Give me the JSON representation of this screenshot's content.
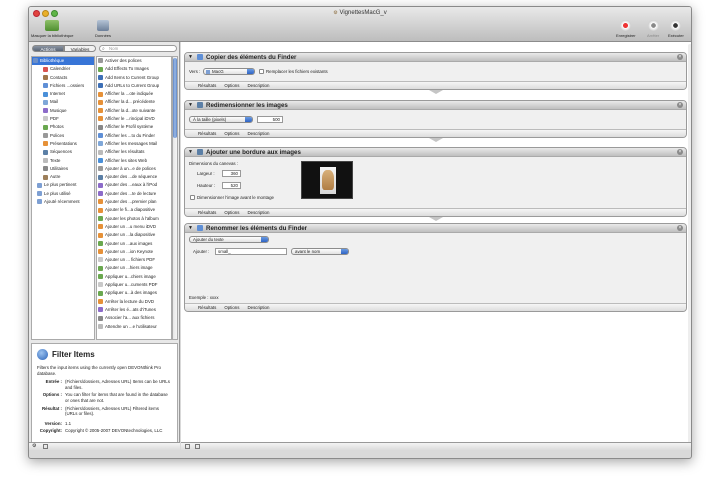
{
  "window": {
    "title": "VignettesMacG_v"
  },
  "toolbar": {
    "hide_library": "Masquer la bibliothèque",
    "data": "Données",
    "record": "Enregistrer",
    "stop": "Arrêter",
    "run": "Exécuter"
  },
  "library_tabs": {
    "actions": "Actions",
    "variables": "Variables"
  },
  "search": {
    "placeholder": "Nom"
  },
  "library": [
    {
      "label": "Bibliothèque",
      "icon": "library-icon",
      "color": "#6b8fc9",
      "selected": true
    },
    {
      "label": "Calendrier",
      "icon": "calendar-icon",
      "color": "#d9534f"
    },
    {
      "label": "Contacts",
      "icon": "contacts-icon",
      "color": "#a0754a"
    },
    {
      "label": "Fichiers ...ossiers",
      "icon": "finder-icon",
      "color": "#5f8fd6"
    },
    {
      "label": "Internet",
      "icon": "globe-icon",
      "color": "#4a90d9"
    },
    {
      "label": "Mail",
      "icon": "mail-icon",
      "color": "#7fa7d8"
    },
    {
      "label": "Musique",
      "icon": "music-icon",
      "color": "#8c6bc9"
    },
    {
      "label": "PDF",
      "icon": "pdf-icon",
      "color": "#c9c9c9"
    },
    {
      "label": "Photos",
      "icon": "photo-icon",
      "color": "#6aa84f"
    },
    {
      "label": "Polices",
      "icon": "font-icon",
      "color": "#999999"
    },
    {
      "label": "Présentations",
      "icon": "presentation-icon",
      "color": "#e69138"
    },
    {
      "label": "Séquences",
      "icon": "movie-icon",
      "color": "#5b7fa6"
    },
    {
      "label": "Texte",
      "icon": "text-icon",
      "color": "#bbbbbb"
    },
    {
      "label": "Utilitaires",
      "icon": "utility-icon",
      "color": "#888888"
    },
    {
      "label": "Autre",
      "icon": "automator-icon",
      "color": "#9d7f5a"
    },
    {
      "label": "Le plus pertinent",
      "icon": "folder-icon",
      "color": "#7d9fd3"
    },
    {
      "label": "Le plus utilisé",
      "icon": "folder-icon",
      "color": "#7d9fd3"
    },
    {
      "label": "Ajouté récemment",
      "icon": "folder-icon",
      "color": "#7d9fd3"
    }
  ],
  "actions": [
    {
      "label": "Activer des polices",
      "color": "#999999"
    },
    {
      "label": "Add Effects To Images",
      "color": "#6aa84f"
    },
    {
      "label": "Add Items to Current Group",
      "color": "#3d6fb6"
    },
    {
      "label": "Add URLs to Current Group",
      "color": "#3d6fb6"
    },
    {
      "label": "Afficher la ...ote indiquée",
      "color": "#e69138"
    },
    {
      "label": "Afficher la d... précédente",
      "color": "#e69138"
    },
    {
      "label": "Afficher la d...ote suivante",
      "color": "#e69138"
    },
    {
      "label": "Afficher le ...rincipal iDVD",
      "color": "#e69138"
    },
    {
      "label": "Afficher le Profil système",
      "color": "#888888"
    },
    {
      "label": "Afficher les ...to du Finder",
      "color": "#5f8fd6"
    },
    {
      "label": "Afficher les messages Mail",
      "color": "#7fa7d8"
    },
    {
      "label": "Afficher les résultats",
      "color": "#bbbbbb"
    },
    {
      "label": "Afficher les sites Web",
      "color": "#4a90d9"
    },
    {
      "label": "Ajouter à un...e de polices",
      "color": "#999999"
    },
    {
      "label": "Ajouter des ...de séquence",
      "color": "#5b7fa6"
    },
    {
      "label": "Ajouter des ...eaux à l'iPod",
      "color": "#8c6bc9"
    },
    {
      "label": "Ajouter des ...te de lecture",
      "color": "#8c6bc9"
    },
    {
      "label": "Ajouter des ...premier plan",
      "color": "#e69138"
    },
    {
      "label": "Ajouter le fi...a diapositive",
      "color": "#e69138"
    },
    {
      "label": "Ajouter les photos à l'album",
      "color": "#6aa84f"
    },
    {
      "label": "Ajouter un ...u menu iDVD",
      "color": "#e69138"
    },
    {
      "label": "Ajouter un ...la diapositive",
      "color": "#e69138"
    },
    {
      "label": "Ajouter un ...aux images",
      "color": "#6aa84f"
    },
    {
      "label": "Ajouter un ...ion Keynote",
      "color": "#e69138"
    },
    {
      "label": "Ajouter un ... fichiers PDF",
      "color": "#c9c9c9"
    },
    {
      "label": "Ajouter un ...hiers image",
      "color": "#6aa84f"
    },
    {
      "label": "Appliquer u...chiers image",
      "color": "#6aa84f"
    },
    {
      "label": "Appliquer u...cuments PDF",
      "color": "#c9c9c9"
    },
    {
      "label": "Appliquer u...à des images",
      "color": "#6aa84f"
    },
    {
      "label": "Arrêter la lecture du DVD",
      "color": "#e69138"
    },
    {
      "label": "Arrêter les é...ats d'iTunes",
      "color": "#8c6bc9"
    },
    {
      "label": "Associer l'a... aux fichiers",
      "color": "#888888"
    },
    {
      "label": "Attendre un ...e l'utilisateur",
      "color": "#bbbbbb"
    }
  ],
  "description": {
    "title": "Filter Items",
    "summary": "Filters the input items using the currently open DEVONthink Pro database.",
    "input_label": "Entrée :",
    "input_value": "(Fichiers/dossiers, Adresses URL) Items can be URLs and files.",
    "options_label": "Options :",
    "options_value": "You can filter for items that are found in the database or ones that are not.",
    "result_label": "Résultat :",
    "result_value": "(Fichiers/dossiers, Adresses URL) Filtered items (URLs or files).",
    "version_label": "Version:",
    "version_value": "1.1",
    "copyright_label": "Copyright:",
    "copyright_value": "Copyright © 2005-2007 DEVONtechnologies, LLC"
  },
  "card_footer": {
    "results": "Résultats",
    "options": "Options",
    "description": "Description"
  },
  "workflow": {
    "copy": {
      "title": "Copier des éléments du Finder",
      "to_label": "Vers :",
      "to_value": "MacG",
      "replace_label": "Remplacer les fichiers existants"
    },
    "resize": {
      "title": "Redimensionner les images",
      "mode_value": "À la taille (pixels)",
      "size_value": "500"
    },
    "border": {
      "title": "Ajouter une bordure aux images",
      "canvas_label": "Dimensions du canevas :",
      "width_label": "Largeur :",
      "width_value": "360",
      "height_label": "Hauteur :",
      "height_value": "520",
      "scale_label": "Dimensionner l'image avant le montage"
    },
    "rename": {
      "title": "Renommer les éléments du Finder",
      "mode_value": "Ajouter du texte",
      "add_label": "Ajouter :",
      "add_value": "small_",
      "position_value": "avant le nom",
      "example": "Exemple : xxxx"
    }
  }
}
